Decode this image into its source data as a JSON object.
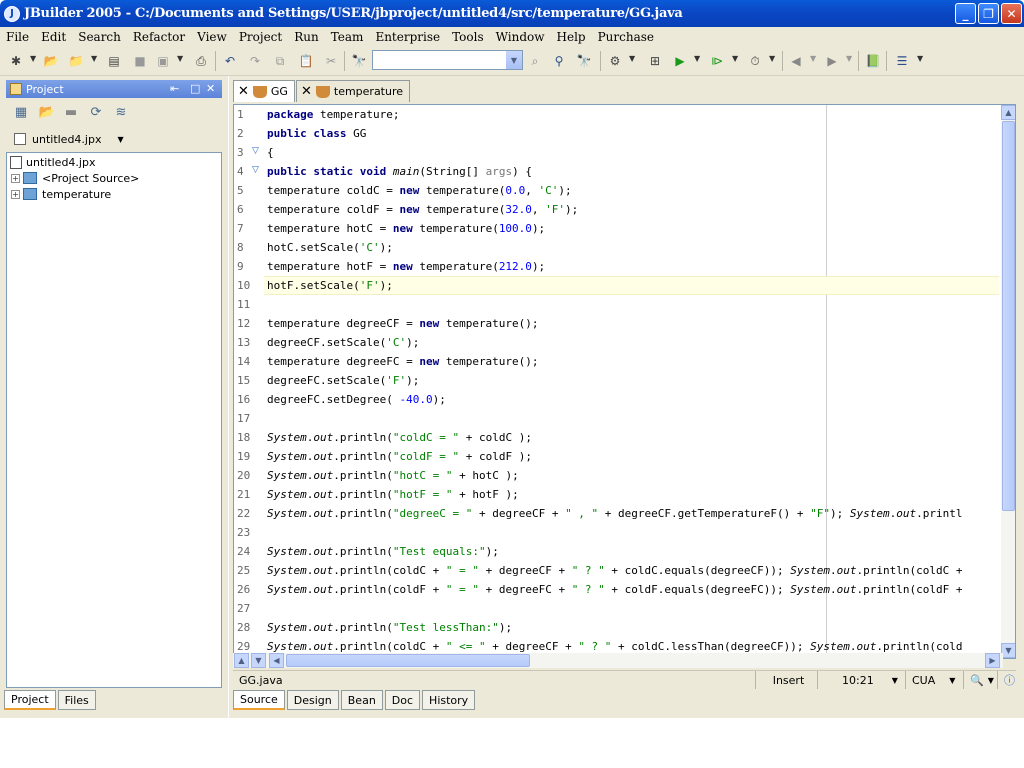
{
  "window": {
    "title": "JBuilder 2005 - C:/Documents and Settings/USER/jbproject/untitled4/src/temperature/GG.java",
    "buttons": [
      "minimize",
      "maximize",
      "close"
    ]
  },
  "menu": [
    "File",
    "Edit",
    "Search",
    "Refactor",
    "View",
    "Project",
    "Run",
    "Team",
    "Enterprise",
    "Tools",
    "Window",
    "Help",
    "Purchase"
  ],
  "toolbar": {
    "icons": [
      "new-icon",
      "open-icon",
      "reopen-icon",
      "copy-project-icon",
      "save-icon",
      "save-all-icon",
      "print-icon",
      "undo-icon",
      "redo-icon",
      "copy-icon",
      "paste-icon",
      "cut-icon",
      "find-icon",
      "search-combo",
      "find-in-path-icon",
      "find-classes-icon",
      "binoculars-icon",
      "make-icon",
      "run-icon",
      "debug-icon",
      "optimize-icon",
      "back-icon",
      "forward-icon",
      "help-book-icon",
      "layers-icon"
    ],
    "combo_value": ""
  },
  "project_panel": {
    "title": "Project",
    "project_file": "untitled4.jpx",
    "tree": [
      {
        "label": "untitled4.jpx",
        "level": 0
      },
      {
        "label": "<Project Source>",
        "level": 1
      },
      {
        "label": "temperature",
        "level": 1
      }
    ],
    "tabs": [
      "Project",
      "Files"
    ],
    "active_tab": "Project"
  },
  "editor": {
    "tabs": [
      {
        "label": "GG",
        "active": true
      },
      {
        "label": "temperature",
        "active": false
      }
    ],
    "line_numbers": [
      "1",
      "2",
      "3",
      "4",
      "5",
      "6",
      "7",
      "8",
      "9",
      "10",
      "11",
      "12",
      "13",
      "14",
      "15",
      "16",
      "17",
      "18",
      "19",
      "20",
      "21",
      "22",
      "23",
      "24",
      "25",
      "26",
      "27",
      "28",
      "29"
    ],
    "highlighted_line": 10,
    "code_lines": [
      "package temperature;",
      "public class GG",
      "{",
      "public static void main(String[] args) {",
      "temperature coldC = new temperature(0.0, 'C');",
      "temperature coldF = new temperature(32.0, 'F');",
      "temperature hotC = new temperature(100.0);",
      "hotC.setScale('C');",
      "temperature hotF = new temperature(212.0);",
      "hotF.setScale('F');",
      "",
      "temperature degreeCF = new temperature();",
      "degreeCF.setScale('C');",
      "temperature degreeFC = new temperature();",
      "degreeFC.setScale('F');",
      "degreeFC.setDegree( -40.0);",
      "",
      "System.out.println(\"coldC = \" + coldC );",
      "System.out.println(\"coldF = \" + coldF );",
      "System.out.println(\"hotC = \" + hotC );",
      "System.out.println(\"hotF = \" + hotF );",
      "System.out.println(\"degreeC = \" + degreeCF + \" , \" + degreeCF.getTemperatureF() + \"F\"); System.out.printl",
      "",
      "System.out.println(\"Test equals:\");",
      "System.out.println(coldC + \" = \" + degreeCF + \" ? \" + coldC.equals(degreeCF)); System.out.println(coldC +",
      "System.out.println(coldF + \" = \" + degreeFC + \" ? \" + coldF.equals(degreeFC)); System.out.println(coldF +",
      "",
      "System.out.println(\"Test lessThan:\");",
      "System.out.println(coldC + \" <= \" + degreeCF + \" ? \" + coldC.lessThan(degreeCF)); System.out.println(cold"
    ],
    "status": {
      "file": "GG.java",
      "mode": "Insert",
      "position": "10:21",
      "keymap": "CUA"
    },
    "bottom_tabs": [
      "Source",
      "Design",
      "Bean",
      "Doc",
      "History"
    ],
    "active_bottom_tab": "Source"
  }
}
